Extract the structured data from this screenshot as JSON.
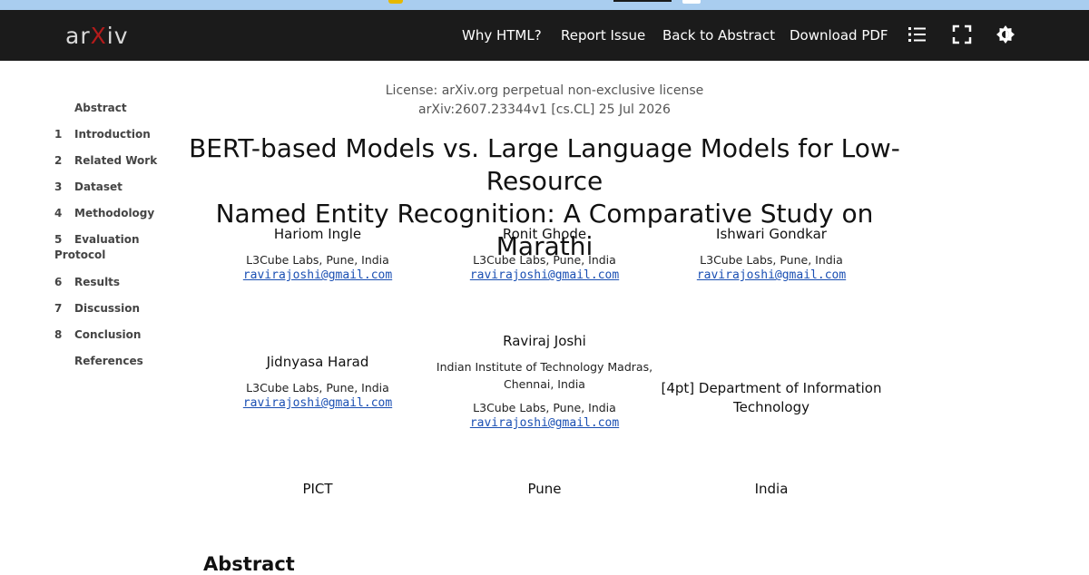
{
  "nav": {
    "logo_text_1": "ar",
    "logo_x": "X",
    "logo_text_2": "iv",
    "why_html": "Why HTML?",
    "report_issue": "Report Issue",
    "back_to_abstract": "Back to Abstract",
    "download_pdf": "Download PDF"
  },
  "toc": {
    "items": [
      {
        "num": "",
        "label": "Abstract"
      },
      {
        "num": "1",
        "label": "Introduction"
      },
      {
        "num": "2",
        "label": "Related Work"
      },
      {
        "num": "3",
        "label": "Dataset"
      },
      {
        "num": "4",
        "label": "Methodology"
      },
      {
        "num": "5",
        "label": "Evaluation",
        "label2": "Protocol"
      },
      {
        "num": "6",
        "label": "Results"
      },
      {
        "num": "7",
        "label": "Discussion"
      },
      {
        "num": "8",
        "label": "Conclusion"
      },
      {
        "num": "",
        "label": "References"
      }
    ]
  },
  "paper": {
    "license": "License: arXiv.org perpetual non-exclusive license",
    "arxiv_id": "arXiv:2607.23344v1 [cs.CL] 25 Jul 2026",
    "title_line1": "BERT-based Models vs. Large Language Models for Low-Resource",
    "title_line2": "Named Entity Recognition: A Comparative Study on Marathi",
    "authors": [
      {
        "name": "Hariom Ingle",
        "aff": "L3Cube Labs, Pune, India",
        "email": "ravirajoshi@gmail.com"
      },
      {
        "name": "Ronit Ghode",
        "aff": "L3Cube Labs, Pune, India",
        "email": "ravirajoshi@gmail.com"
      },
      {
        "name": "Ishwari Gondkar",
        "aff": "L3Cube Labs, Pune, India",
        "email": "ravirajoshi@gmail.com"
      },
      {
        "name": "Jidnyasa Harad",
        "aff": "L3Cube Labs, Pune, India",
        "email": "ravirajoshi@gmail.com"
      },
      {
        "name": "Raviraj Joshi",
        "aff1": "Indian Institute of Technology Madras,",
        "aff1b": "Chennai, India",
        "aff": "L3Cube Labs, Pune, India",
        "email": "ravirajoshi@gmail.com"
      }
    ],
    "dept_line1": "[4pt] Department of Information",
    "dept_line2": "Technology",
    "pict": "PICT",
    "pune": "Pune",
    "india": "India",
    "abstract_heading": "Abstract"
  }
}
